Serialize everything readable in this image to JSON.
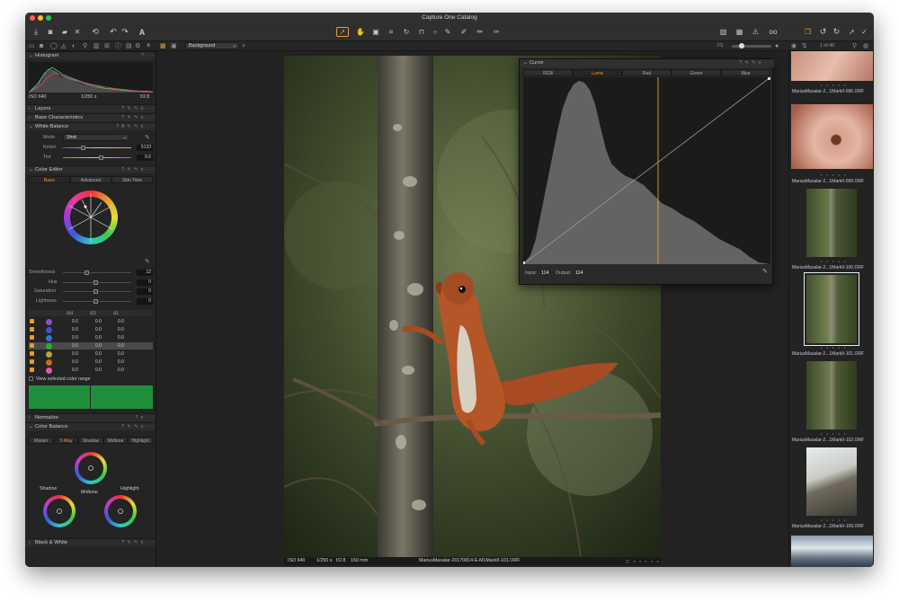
{
  "window": {
    "title": "Capture One Catalog"
  },
  "toolbar2": {
    "style_select": "Background",
    "image_count": "1 of 46"
  },
  "panels": {
    "histogram": {
      "title": "Histogram",
      "iso": "ISO 640",
      "shutter": "1/250 s",
      "aperture": "f/2.8"
    },
    "layers": {
      "title": "Layers"
    },
    "base": {
      "title": "Base Characteristics"
    },
    "white_balance": {
      "title": "White Balance",
      "mode_label": "Mode",
      "mode_value": "Shot",
      "kelvin_label": "Kelvin",
      "kelvin_value": "5133",
      "tint_label": "Tint",
      "tint_value": "9.6"
    },
    "color_editor": {
      "title": "Color Editor",
      "tabs": [
        "Basic",
        "Advanced",
        "Skin Tone"
      ],
      "smoothness_label": "Smoothness",
      "smoothness_value": "12",
      "hue_label": "Hue",
      "hue_value": "0",
      "saturation_label": "Saturation",
      "saturation_value": "0",
      "lightness_label": "Lightness",
      "lightness_value": "0",
      "col_headers": [
        "ΔH",
        "ΔS",
        "ΔL"
      ],
      "rows": [
        {
          "color": "#8a4fc8",
          "h": "0.0",
          "s": "0.0",
          "l": "0.0"
        },
        {
          "color": "#4a4fd0",
          "h": "0.0",
          "s": "0.0",
          "l": "0.0"
        },
        {
          "color": "#3a6fd8",
          "h": "0.0",
          "s": "0.0",
          "l": "0.0"
        },
        {
          "color": "#2eaa3a",
          "h": "0.0",
          "s": "0.0",
          "l": "0.0"
        },
        {
          "color": "#b8a23a",
          "h": "0.0",
          "s": "0.0",
          "l": "0.0"
        },
        {
          "color": "#c86a2a",
          "h": "0.0",
          "s": "0.0",
          "l": "0.0"
        },
        {
          "color": "#d85ab0",
          "h": "0.0",
          "s": "0.0",
          "l": "0.0"
        }
      ],
      "view_range": "View selected color range"
    },
    "normalize": {
      "title": "Normalize"
    },
    "color_balance": {
      "title": "Color Balance",
      "tabs": [
        "Master",
        "3-Way",
        "Shadow",
        "Midtone",
        "Highlight"
      ],
      "shadow": "Shadow",
      "midtone": "Midtone",
      "highlight": "Highlight"
    },
    "bw": {
      "title": "Black & White"
    }
  },
  "curve": {
    "title": "Curve",
    "tabs": [
      "RGB",
      "Luma",
      "Red",
      "Green",
      "Blue"
    ],
    "input_label": "Input:",
    "input_value": "114",
    "output_label": "Output:",
    "output_value": "114"
  },
  "viewer": {
    "iso": "ISO 640",
    "shutter": "1/250 s",
    "aperture": "f/2.8",
    "focal": "150 mm",
    "filename": "MariusMasalar-20170814-E-M1MarkII-101.ORF"
  },
  "filmstrip": [
    {
      "name": ""
    },
    {
      "name": "MariusMasalar-2...1MarkII-096.ORF"
    },
    {
      "name": "MariusMasalar-2...1MarkII-099.ORF"
    },
    {
      "name": "MariusMasalar-2...1MarkII-100.ORF"
    },
    {
      "name": "MariusMasalar-2...1MarkII-101.ORF"
    },
    {
      "name": "MariusMasalar-2...1MarkII-102.ORF"
    },
    {
      "name": "MariusMasalar-2...1MarkII-109.ORF"
    },
    {
      "name": ""
    }
  ],
  "accent": "#ee9a2c"
}
